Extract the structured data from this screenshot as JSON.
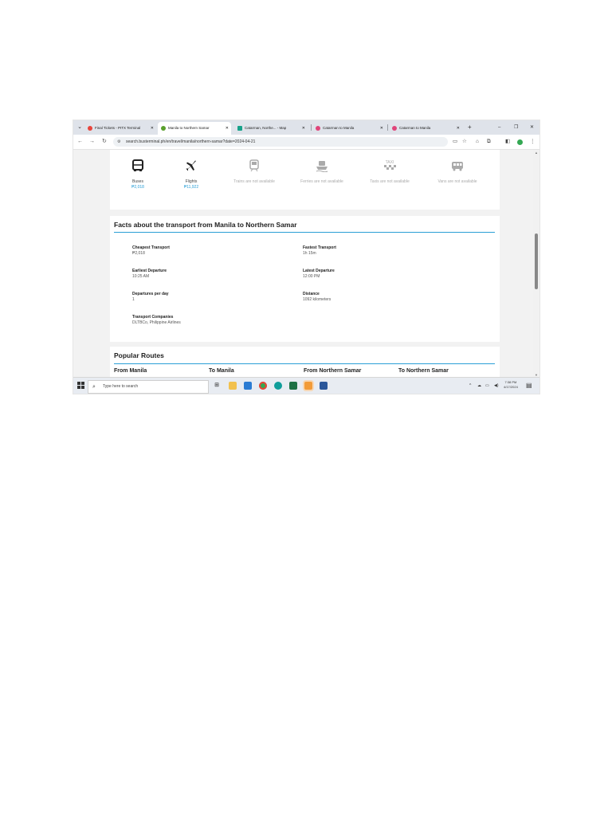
{
  "browser": {
    "tabs": [
      {
        "title": "Final Tickets - PITX Terminal",
        "favicon_color": "#e8453c",
        "active": false
      },
      {
        "title": "Manila to Northern Samar",
        "favicon_color": "#5aa02c",
        "active": true
      },
      {
        "title": "Catarman, Northe... - Map",
        "favicon_color": "#18a28a",
        "active": false
      },
      {
        "title": "Catarman to Manila",
        "favicon_color": "#e0457a",
        "active": false
      },
      {
        "title": "Catarman to Manila",
        "favicon_color": "#e0457a",
        "active": false
      }
    ],
    "new_tab": "+",
    "url": "search.busterminal.ph/en/travel/manila/northern-samar?date=2024-04-21"
  },
  "modes": [
    {
      "label": "Buses",
      "price": "₱2,018",
      "icon": "bus-icon",
      "available": true
    },
    {
      "label": "Flights",
      "price": "₱11,922",
      "icon": "plane-icon",
      "available": true
    },
    {
      "label": "Trains are not available",
      "price": "",
      "icon": "train-icon",
      "available": false
    },
    {
      "label": "Ferries are not available",
      "price": "",
      "icon": "ferry-icon",
      "available": false
    },
    {
      "label": "Taxis are not available",
      "price": "",
      "icon": "taxi-icon",
      "icon_text": "TAXI",
      "available": false
    },
    {
      "label": "Vans are not available",
      "price": "",
      "icon": "van-icon",
      "available": false
    }
  ],
  "facts": {
    "title": "Facts about the transport from Manila to Northern Samar",
    "cheapest_label": "Cheapest Transport",
    "cheapest_value": "₱2,018",
    "fastest_label": "Fastest Transport",
    "fastest_value": "1h 15m",
    "earliest_label": "Earliest Departure",
    "earliest_value": "10:25 AM",
    "latest_label": "Latest Departure",
    "latest_value": "12:00 PM",
    "per_day_label": "Departures per day",
    "per_day_value": "1",
    "distance_label": "Distance",
    "distance_value": "1092 kilometers",
    "companies_label": "Transport Companies",
    "companies_value": "DLTBCo, Philippine Airlines"
  },
  "popular": {
    "title": "Popular Routes",
    "columns": [
      "From Manila",
      "To Manila",
      "From Northern Samar",
      "To Northern Samar"
    ]
  },
  "taskbar": {
    "search_placeholder": "Type here to search",
    "time": "7:38 PM",
    "date": "4/17/2024"
  },
  "colors": {
    "accent": "#2a9fd6"
  }
}
